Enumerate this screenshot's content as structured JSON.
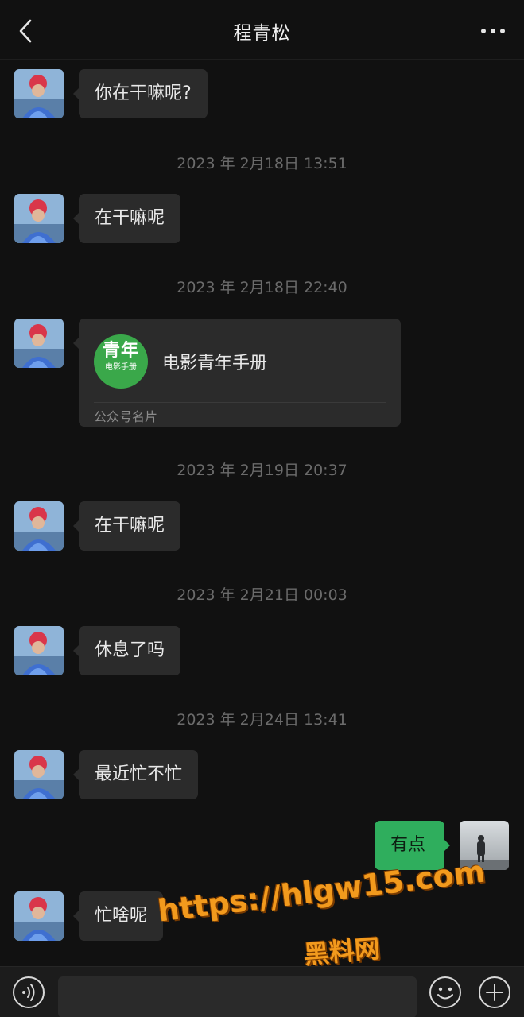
{
  "header": {
    "title": "程青松"
  },
  "messages": {
    "m1": "你在干嘛呢?",
    "t1": "2023 年 2月18日 13:51",
    "m2": "在干嘛呢",
    "t2": "2023 年 2月18日 22:40",
    "card": {
      "logo_big": "青年",
      "logo_small": "电影手册",
      "name": "电影青年手册",
      "type": "公众号名片"
    },
    "t3": "2023 年 2月19日 20:37",
    "m3": "在干嘛呢",
    "t4": "2023 年 2月21日 00:03",
    "m4": "休息了吗",
    "t5": "2023 年 2月24日 13:41",
    "m5": "最近忙不忙",
    "m6_mine": "有点",
    "m7": "忙啥呢"
  },
  "watermark": {
    "url": "https://hlgw15.com",
    "name": "黑料网"
  },
  "input": {
    "value": "",
    "placeholder": ""
  },
  "colors": {
    "background": "#111111",
    "bubble": "#2b2b2b",
    "mine_bubble": "#2fae5d",
    "watermark": "#f29a1d"
  },
  "icons": [
    "back-arrow-icon",
    "more-dots-icon",
    "voice-icon",
    "emoji-icon",
    "plus-icon"
  ]
}
